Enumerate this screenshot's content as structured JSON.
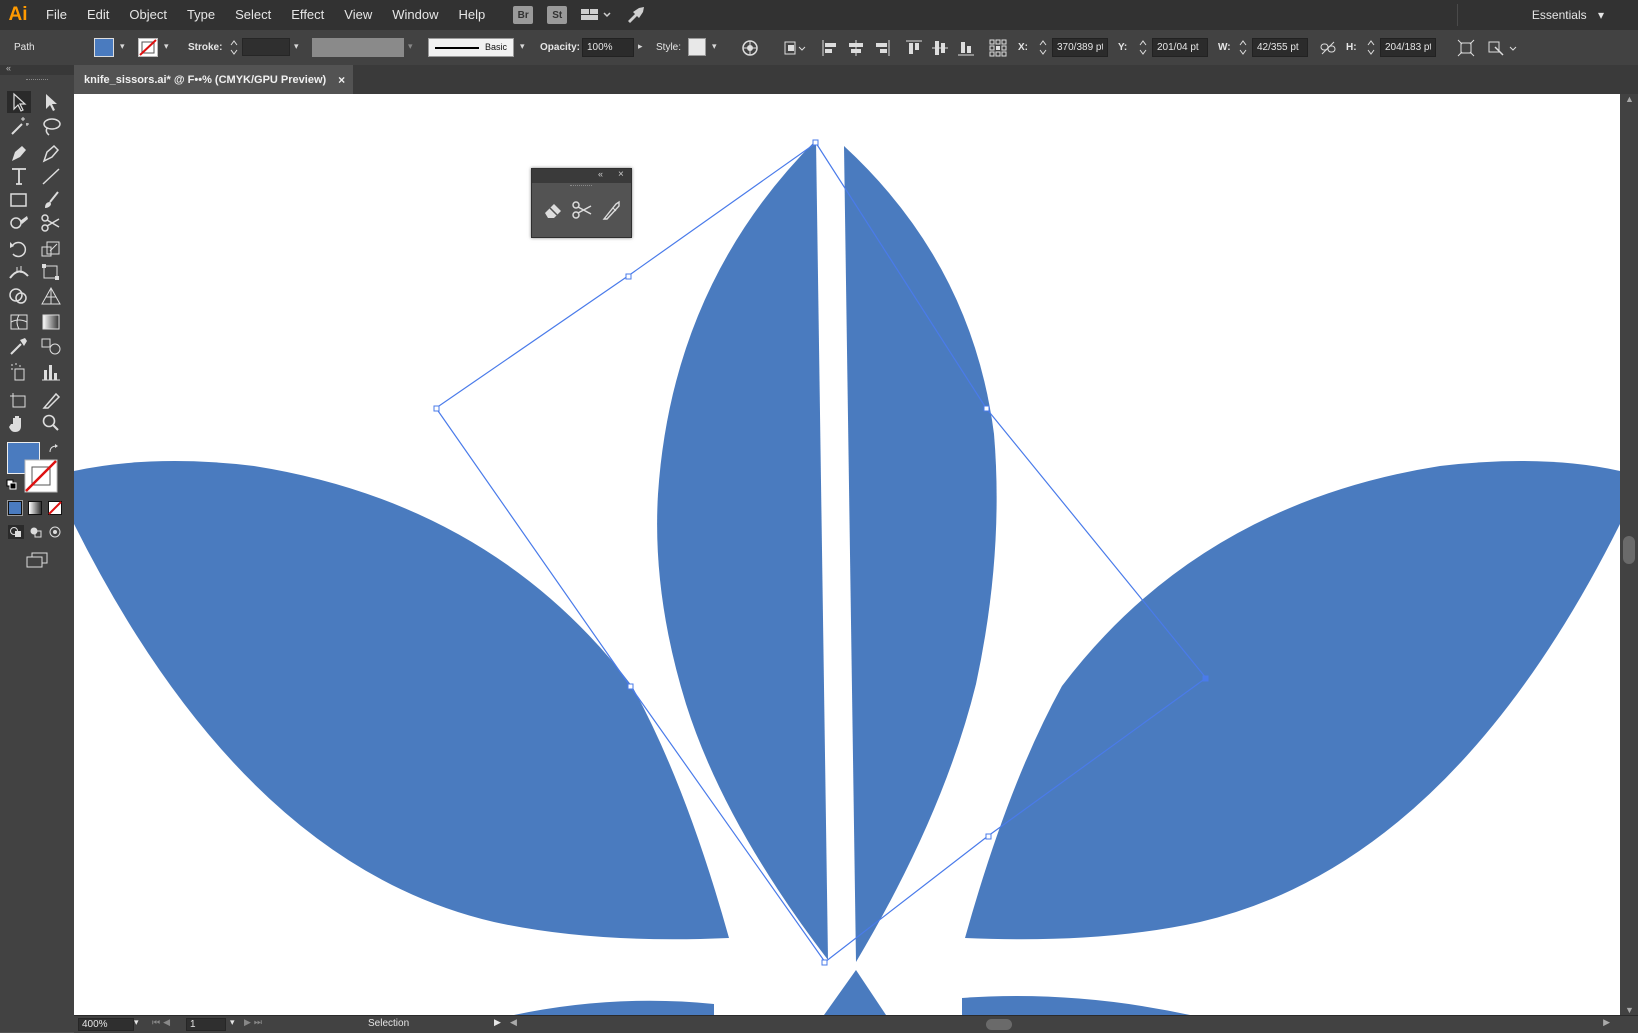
{
  "app": {
    "logo": "Ai",
    "logo_color": "#ff9a00"
  },
  "menu": [
    "File",
    "Edit",
    "Object",
    "Type",
    "Select",
    "Effect",
    "View",
    "Window",
    "Help"
  ],
  "menubar_buttons": {
    "bridge": "Br",
    "stock": "St"
  },
  "workspace": {
    "label": "Essentials"
  },
  "control": {
    "selection_type": "Path",
    "stroke_label": "Stroke:",
    "brush_label": "Basic",
    "opacity_label": "Opacity:",
    "opacity_value": "100%",
    "style_label": "Style:",
    "x_label": "X:",
    "x_value": "370/389 pt",
    "y_label": "Y:",
    "y_value": "201/04 pt",
    "w_label": "W:",
    "w_value": "42/355 pt",
    "h_label": "H:",
    "h_value": "204/183 pt"
  },
  "document_tab": {
    "title": "knife_sissors.ai* @ F••% (CMYK/GPU Preview)",
    "close": "×"
  },
  "status": {
    "zoom": "400%",
    "artboard": "1",
    "tool": "Selection"
  },
  "colors": {
    "fill": "#4a7bbf",
    "shape": "#4a7bbf",
    "selection": "#4a7bea",
    "accent_logo": "#ff9a00"
  },
  "icons": [
    "eraser-icon",
    "scissors-icon",
    "knife-icon"
  ]
}
